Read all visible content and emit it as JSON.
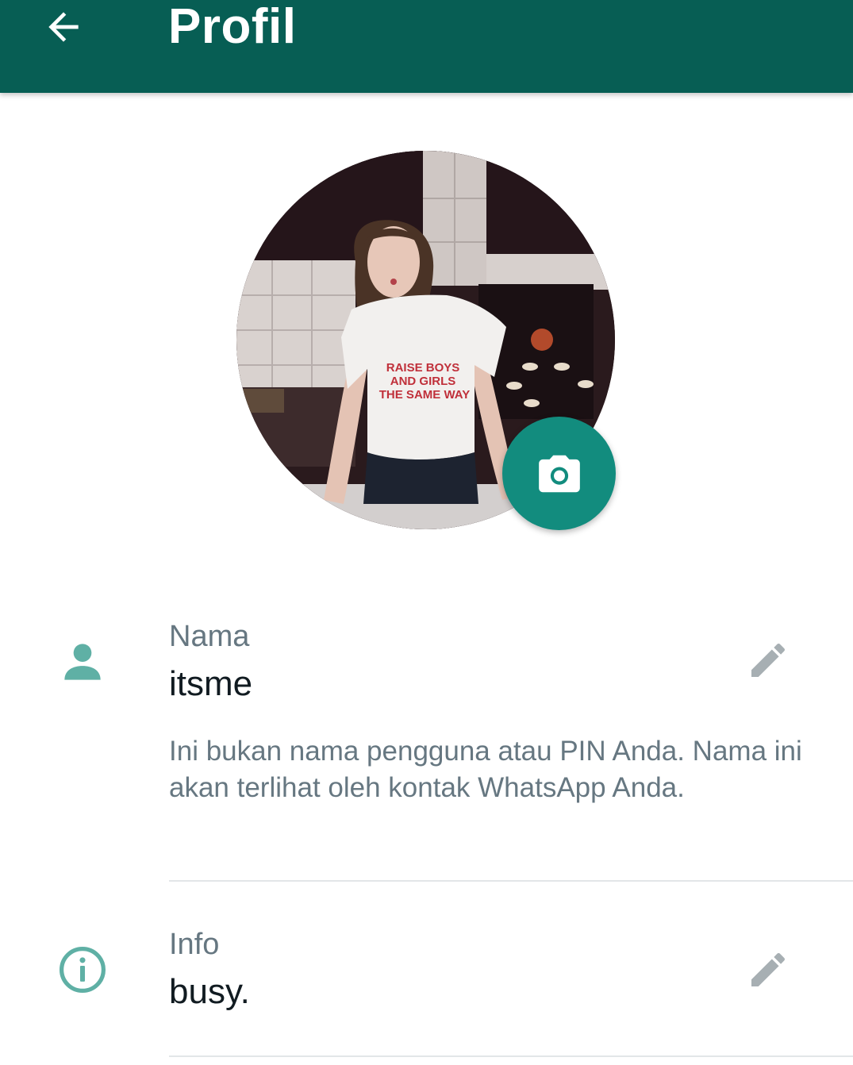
{
  "header": {
    "title": "Profil",
    "back_icon": "arrow-back-icon",
    "background": "#075e54"
  },
  "avatar": {
    "shirt_text": [
      "RAISE BOYS",
      "AND GIRLS",
      "THE SAME WAY"
    ],
    "camera_icon": "camera-icon",
    "camera_button_color": "#128c7e"
  },
  "name_row": {
    "icon": "person-icon",
    "label": "Nama",
    "value": "itsme",
    "edit_icon": "pencil-icon",
    "helper_text": "Ini bukan nama pengguna atau PIN Anda. Nama ini akan terlihat oleh kontak WhatsApp Anda."
  },
  "info_row": {
    "icon": "info-icon",
    "label": "Info",
    "value": "busy.",
    "edit_icon": "pencil-icon"
  },
  "colors": {
    "accent": "#128c7e",
    "icon_teal": "#5fb0a5",
    "secondary_text": "#667781",
    "primary_text": "#111b21"
  }
}
